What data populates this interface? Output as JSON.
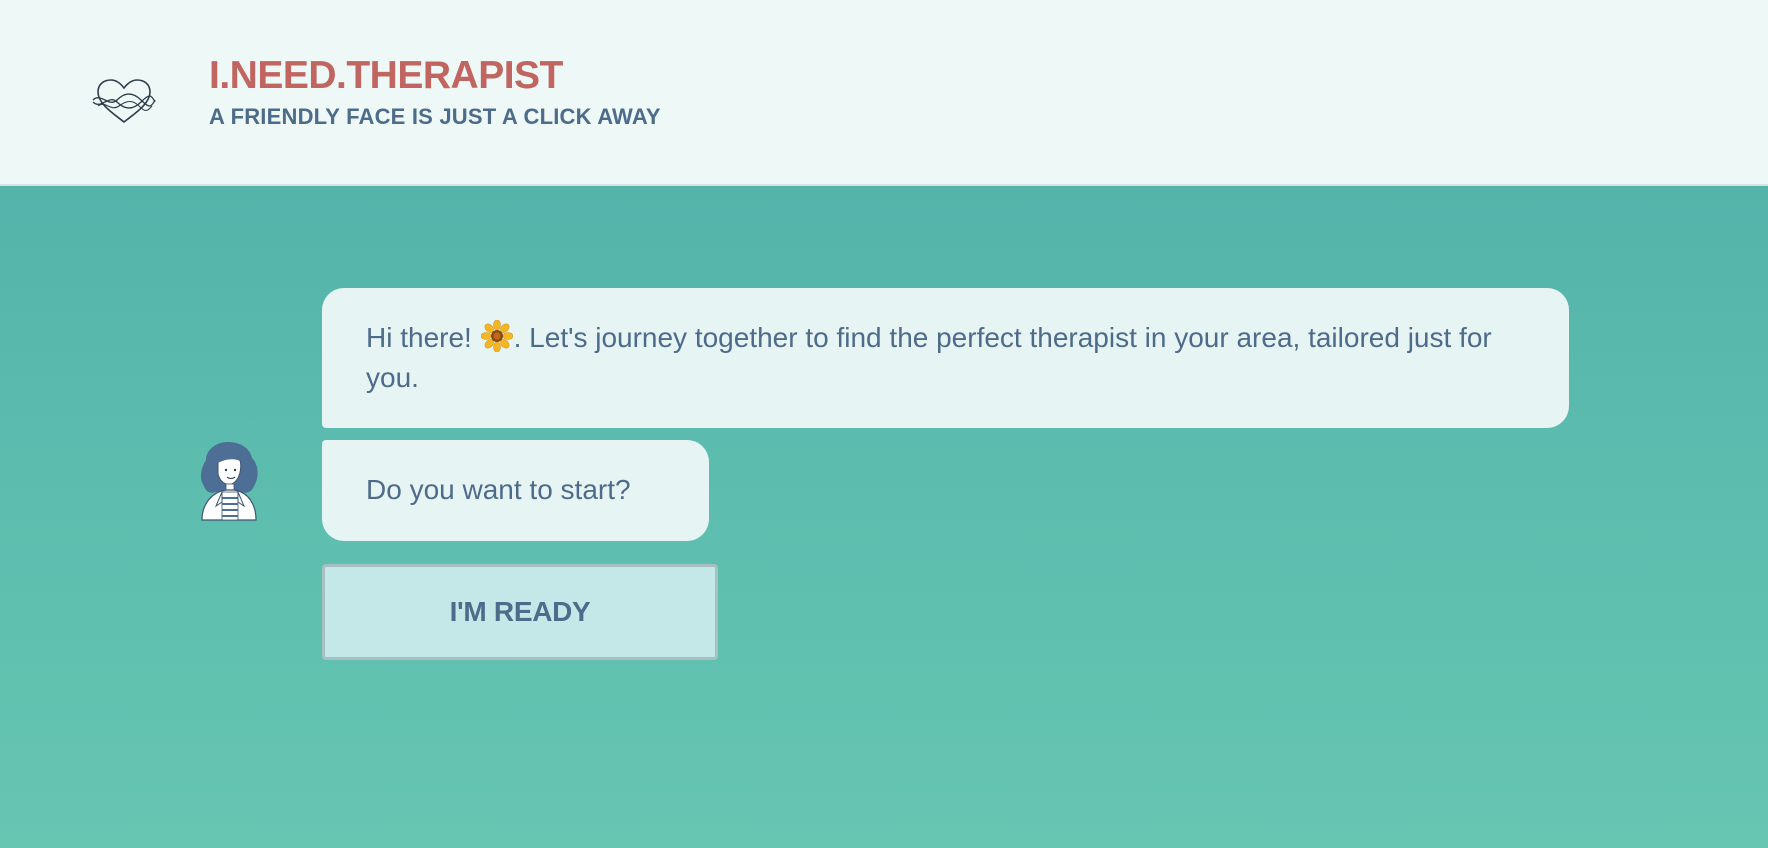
{
  "header": {
    "logo_icon": "heart-waves-icon",
    "title": "I.NEED.THERAPIST",
    "tagline": "A FRIENDLY FACE IS JUST A CLICK AWAY"
  },
  "chat": {
    "avatar_icon": "therapist-avatar",
    "messages": [
      {
        "text_before": "Hi there! ",
        "emoji": "sunflower-icon",
        "text_after": ". Let's journey together to find the perfect therapist in your area, tailored just for you."
      },
      {
        "text": "Do you want to start?"
      }
    ],
    "action_button": "I'M READY"
  },
  "colors": {
    "brand_title": "#c0655f",
    "text": "#4d6b8a",
    "header_bg": "#edf8f7",
    "bubble_bg": "#e7f4f4",
    "button_bg": "#c4e8e8",
    "page_bg_top": "#4faea8",
    "page_bg_bottom": "#66c6b2"
  }
}
